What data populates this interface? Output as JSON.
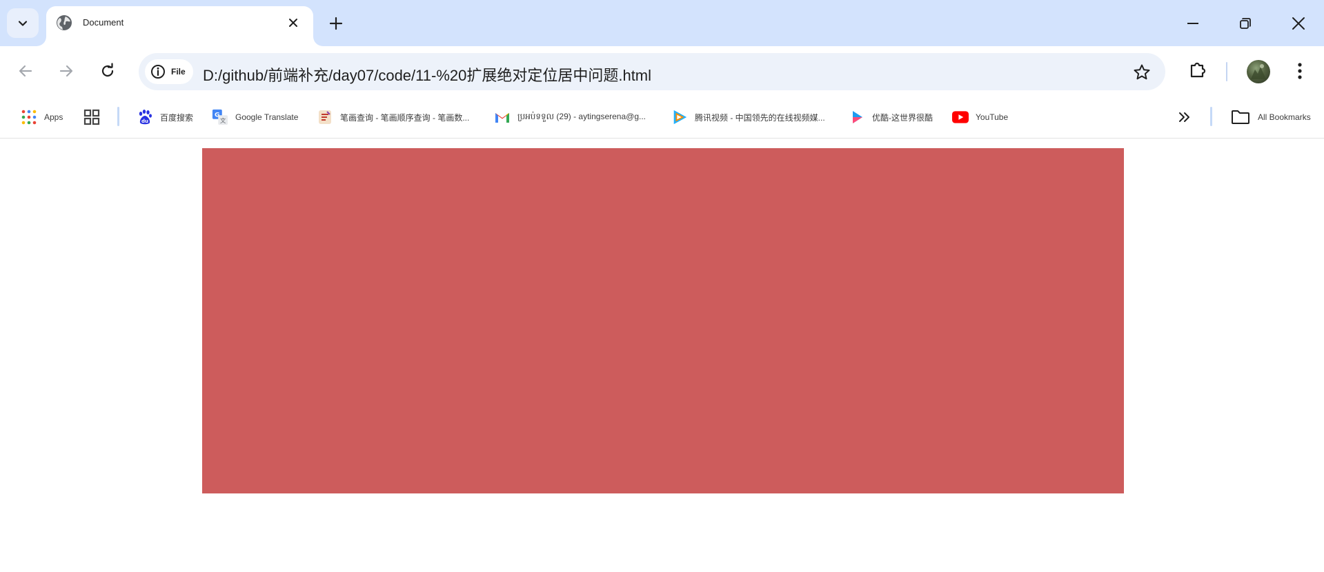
{
  "colors": {
    "tabstrip_bg": "#d3e3fd",
    "omnibox_bg": "#edf2fa",
    "box_color": "#cd5c5c"
  },
  "tabs": [
    {
      "title": "Document",
      "favicon": "globe-icon",
      "active": true
    }
  ],
  "omnibox": {
    "site_chip_label": "File",
    "url": "D:/github/前端补充/day07/code/11-%20扩展绝对定位居中问题.html"
  },
  "bookmarks": {
    "apps_label": "Apps",
    "items": [
      {
        "label": "百度搜索",
        "icon": "baidu-icon"
      },
      {
        "label": "Google Translate",
        "icon": "google-translate-icon"
      },
      {
        "label": "笔画查询 - 笔画顺序查询 - 笔画数...",
        "icon": "stroke-lookup-icon"
      },
      {
        "label": "ប្រអប់ទទួល (29) - aytingserena@g...",
        "icon": "gmail-icon"
      },
      {
        "label": "腾讯视频 - 中国领先的在线视频媒...",
        "icon": "tencent-video-icon"
      },
      {
        "label": "优酷-这世界很酷",
        "icon": "youku-icon"
      },
      {
        "label": "YouTube",
        "icon": "youtube-icon"
      }
    ],
    "all_bookmarks_label": "All Bookmarks"
  }
}
